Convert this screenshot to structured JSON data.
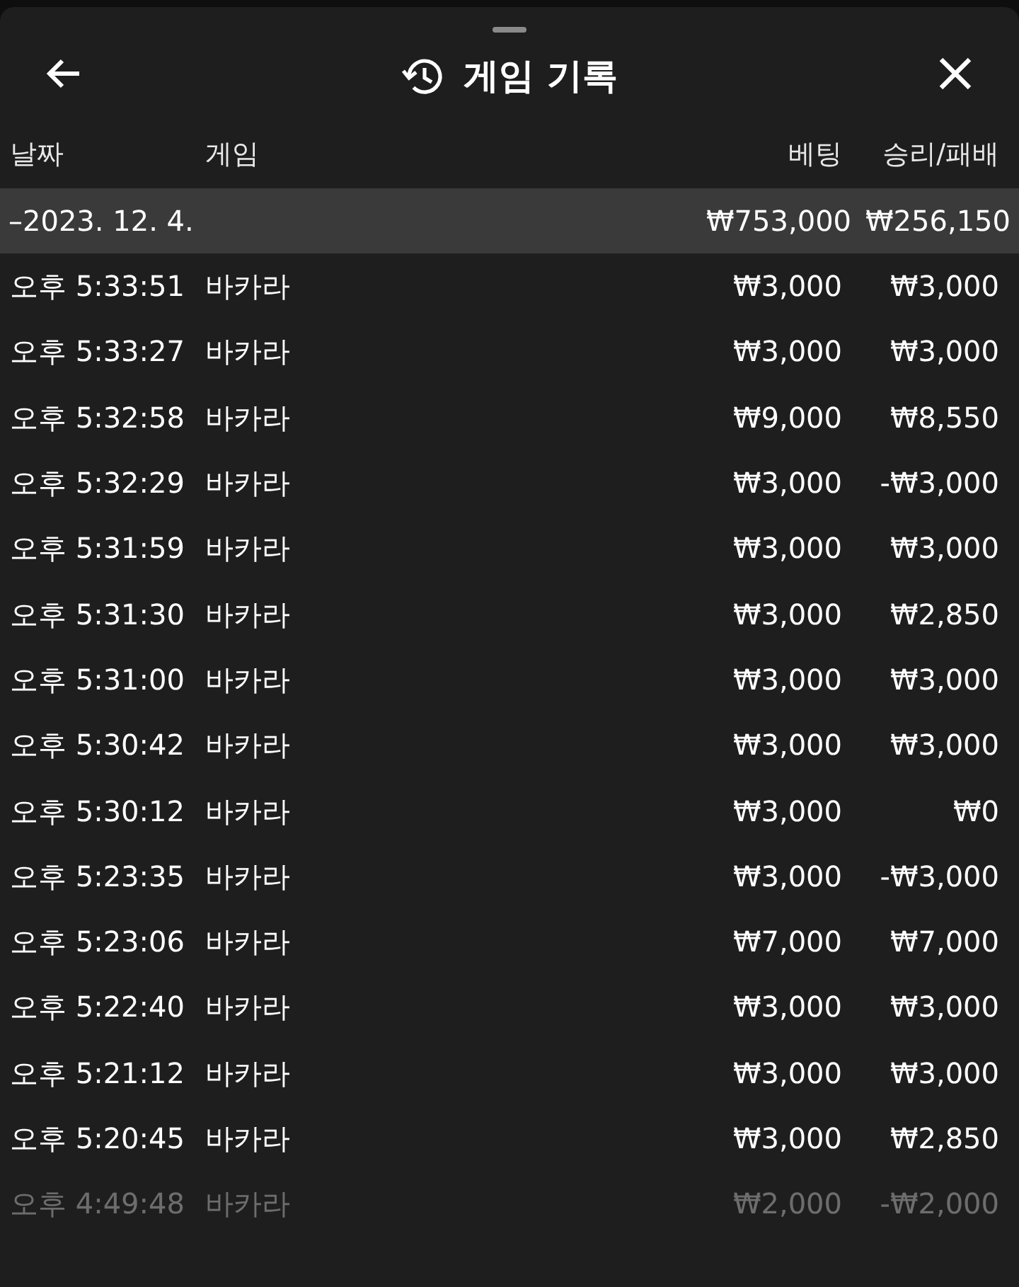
{
  "header": {
    "title": "게임 기록"
  },
  "columns": [
    "날짜",
    "게임",
    "베팅",
    "승리/패배"
  ],
  "date_group": {
    "date": "–2023. 12. 4.",
    "bet_total": "₩753,000",
    "result_total": "₩256,150"
  },
  "rows": [
    {
      "time": "오후 5:33:51",
      "game": "바카라",
      "bet": "₩3,000",
      "result": "₩3,000",
      "dimmed": false
    },
    {
      "time": "오후 5:33:27",
      "game": "바카라",
      "bet": "₩3,000",
      "result": "₩3,000",
      "dimmed": false
    },
    {
      "time": "오후 5:32:58",
      "game": "바카라",
      "bet": "₩9,000",
      "result": "₩8,550",
      "dimmed": false
    },
    {
      "time": "오후 5:32:29",
      "game": "바카라",
      "bet": "₩3,000",
      "result": "-₩3,000",
      "dimmed": false
    },
    {
      "time": "오후 5:31:59",
      "game": "바카라",
      "bet": "₩3,000",
      "result": "₩3,000",
      "dimmed": false
    },
    {
      "time": "오후 5:31:30",
      "game": "바카라",
      "bet": "₩3,000",
      "result": "₩2,850",
      "dimmed": false
    },
    {
      "time": "오후 5:31:00",
      "game": "바카라",
      "bet": "₩3,000",
      "result": "₩3,000",
      "dimmed": false
    },
    {
      "time": "오후 5:30:42",
      "game": "바카라",
      "bet": "₩3,000",
      "result": "₩3,000",
      "dimmed": false
    },
    {
      "time": "오후 5:30:12",
      "game": "바카라",
      "bet": "₩3,000",
      "result": "₩0",
      "dimmed": false
    },
    {
      "time": "오후 5:23:35",
      "game": "바카라",
      "bet": "₩3,000",
      "result": "-₩3,000",
      "dimmed": false
    },
    {
      "time": "오후 5:23:06",
      "game": "바카라",
      "bet": "₩7,000",
      "result": "₩7,000",
      "dimmed": false
    },
    {
      "time": "오후 5:22:40",
      "game": "바카라",
      "bet": "₩3,000",
      "result": "₩3,000",
      "dimmed": false
    },
    {
      "time": "오후 5:21:12",
      "game": "바카라",
      "bet": "₩3,000",
      "result": "₩3,000",
      "dimmed": false
    },
    {
      "time": "오후 5:20:45",
      "game": "바카라",
      "bet": "₩3,000",
      "result": "₩2,850",
      "dimmed": false
    },
    {
      "time": "오후 4:49:48",
      "game": "바카라",
      "bet": "₩2,000",
      "result": "-₩2,000",
      "dimmed": true
    }
  ]
}
